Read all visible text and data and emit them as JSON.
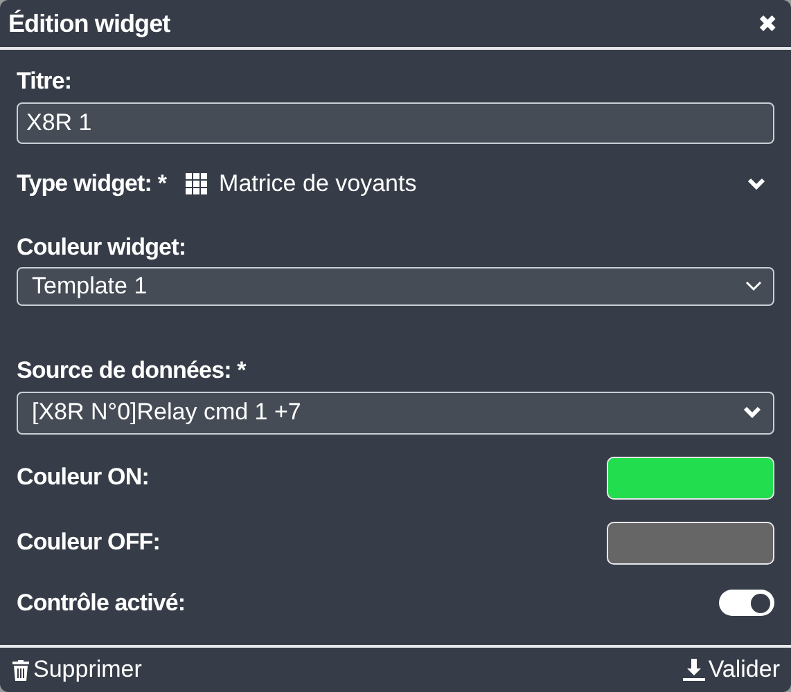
{
  "window": {
    "title": "Édition widget",
    "close": "✖"
  },
  "fields": [
    {
      "kind": "text",
      "label": "Titre:",
      "value": "X8R 1"
    },
    {
      "kind": "type",
      "label": "Type widget: *",
      "value": "Matrice de voyants"
    },
    {
      "kind": "select",
      "label": "Couleur widget:",
      "value": "Template 1"
    },
    {
      "kind": "dropdown",
      "label": "Source de données: *",
      "value": "[X8R N°0]Relay cmd 1 +7"
    },
    {
      "kind": "color",
      "label": "Couleur ON:",
      "color": "#22dd4d"
    },
    {
      "kind": "color",
      "label": "Couleur OFF:",
      "color": "#666666"
    },
    {
      "kind": "toggle",
      "label": "Contrôle activé:",
      "on": true
    }
  ],
  "footer": {
    "delete": "Supprimer",
    "submit": "Valider"
  }
}
